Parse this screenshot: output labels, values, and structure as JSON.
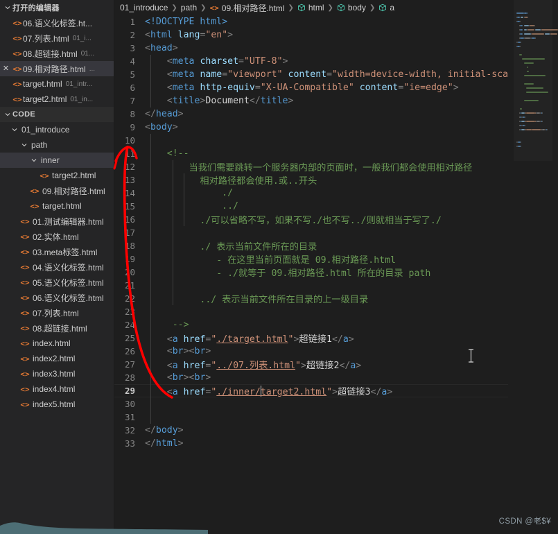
{
  "colors": {
    "editor_bg": "#1e1e1e",
    "sidebar_bg": "#252526",
    "active_row": "#37373d",
    "accent_orange": "#e37933",
    "comment_green": "#6a9955",
    "tag_blue": "#569cd6",
    "attr_lightblue": "#9cdcfe",
    "string_orange": "#ce9178",
    "annotation_red": "#ff0000",
    "teal_band": "#4d6e75"
  },
  "sidebar": {
    "open_editors": {
      "label": "打开的编辑器",
      "chevron": "chevron-down-icon",
      "items": [
        {
          "name": "06.语义化标签.ht...",
          "path": "",
          "icon": "html-file-icon",
          "active": false,
          "close": false
        },
        {
          "name": "07.列表.html",
          "path": "01_i...",
          "icon": "html-file-icon",
          "active": false,
          "close": false
        },
        {
          "name": "08.超链接.html",
          "path": "01...",
          "icon": "html-file-icon",
          "active": false,
          "close": false
        },
        {
          "name": "09.相对路径.html",
          "path": "...",
          "icon": "html-file-icon",
          "active": true,
          "close": true
        },
        {
          "name": "target.html",
          "path": "01_intr...",
          "icon": "html-file-icon",
          "active": false,
          "close": false
        },
        {
          "name": "target2.html",
          "path": "01_in...",
          "icon": "html-file-icon",
          "active": false,
          "close": false
        }
      ],
      "close_glyph": "✕"
    },
    "explorer": {
      "label": "CODE",
      "chevron": "chevron-down-icon",
      "tree": [
        {
          "label": "01_introduce",
          "type": "folder",
          "depth": 1,
          "expanded": true,
          "active": false
        },
        {
          "label": "path",
          "type": "folder",
          "depth": 2,
          "expanded": true,
          "active": false
        },
        {
          "label": "inner",
          "type": "folder",
          "depth": 3,
          "expanded": true,
          "active": true
        },
        {
          "label": "target2.html",
          "type": "file",
          "depth": 4,
          "expanded": false,
          "active": false
        },
        {
          "label": "09.相对路径.html",
          "type": "file",
          "depth": 3,
          "expanded": false,
          "active": false
        },
        {
          "label": "target.html",
          "type": "file",
          "depth": 3,
          "expanded": false,
          "active": false
        },
        {
          "label": "01.测试编辑器.html",
          "type": "file",
          "depth": 2,
          "expanded": false,
          "active": false
        },
        {
          "label": "02.实体.html",
          "type": "file",
          "depth": 2,
          "expanded": false,
          "active": false
        },
        {
          "label": "03.meta标签.html",
          "type": "file",
          "depth": 2,
          "expanded": false,
          "active": false
        },
        {
          "label": "04.语义化标签.html",
          "type": "file",
          "depth": 2,
          "expanded": false,
          "active": false
        },
        {
          "label": "05.语义化标签.html",
          "type": "file",
          "depth": 2,
          "expanded": false,
          "active": false
        },
        {
          "label": "06.语义化标签.html",
          "type": "file",
          "depth": 2,
          "expanded": false,
          "active": false
        },
        {
          "label": "07.列表.html",
          "type": "file",
          "depth": 2,
          "expanded": false,
          "active": false
        },
        {
          "label": "08.超链接.html",
          "type": "file",
          "depth": 2,
          "expanded": false,
          "active": false
        },
        {
          "label": "index.html",
          "type": "file",
          "depth": 2,
          "expanded": false,
          "active": false
        },
        {
          "label": "index2.html",
          "type": "file",
          "depth": 2,
          "expanded": false,
          "active": false
        },
        {
          "label": "index3.html",
          "type": "file",
          "depth": 2,
          "expanded": false,
          "active": false
        },
        {
          "label": "index4.html",
          "type": "file",
          "depth": 2,
          "expanded": false,
          "active": false
        },
        {
          "label": "index5.html",
          "type": "file",
          "depth": 2,
          "expanded": false,
          "active": false
        }
      ]
    }
  },
  "breadcrumb": {
    "separator": "❯",
    "items": [
      {
        "label": "01_introduce",
        "icon": ""
      },
      {
        "label": "path",
        "icon": ""
      },
      {
        "label": "09.相对路径.html",
        "icon": "html-file-icon"
      },
      {
        "label": "html",
        "icon": "symbol-cube-icon"
      },
      {
        "label": "body",
        "icon": "symbol-cube-icon"
      },
      {
        "label": "a",
        "icon": "symbol-cube-icon"
      }
    ]
  },
  "editor": {
    "active_line": 29,
    "total_lines": 33,
    "lines": [
      {
        "n": 1,
        "tokens": [
          {
            "t": "dtd",
            "s": "<!DOCTYPE "
          },
          {
            "t": "name",
            "s": "html"
          },
          {
            "t": "dtd",
            "s": ">"
          }
        ]
      },
      {
        "n": 2,
        "tokens": [
          {
            "t": "pun",
            "s": "<"
          },
          {
            "t": "tag",
            "s": "html"
          },
          {
            "t": "txt",
            "s": " "
          },
          {
            "t": "attr",
            "s": "lang"
          },
          {
            "t": "pun",
            "s": "="
          },
          {
            "t": "str",
            "s": "\"en\""
          },
          {
            "t": "pun",
            "s": ">"
          }
        ]
      },
      {
        "n": 3,
        "tokens": [
          {
            "t": "pun",
            "s": "<"
          },
          {
            "t": "tag",
            "s": "head"
          },
          {
            "t": "pun",
            "s": ">"
          }
        ]
      },
      {
        "n": 4,
        "tokens": [
          {
            "t": "txt",
            "s": "    "
          },
          {
            "t": "pun",
            "s": "<"
          },
          {
            "t": "tag",
            "s": "meta"
          },
          {
            "t": "txt",
            "s": " "
          },
          {
            "t": "attr",
            "s": "charset"
          },
          {
            "t": "pun",
            "s": "="
          },
          {
            "t": "str",
            "s": "\"UTF-8\""
          },
          {
            "t": "pun",
            "s": ">"
          }
        ]
      },
      {
        "n": 5,
        "tokens": [
          {
            "t": "txt",
            "s": "    "
          },
          {
            "t": "pun",
            "s": "<"
          },
          {
            "t": "tag",
            "s": "meta"
          },
          {
            "t": "txt",
            "s": " "
          },
          {
            "t": "attr",
            "s": "name"
          },
          {
            "t": "pun",
            "s": "="
          },
          {
            "t": "str",
            "s": "\"viewport\""
          },
          {
            "t": "txt",
            "s": " "
          },
          {
            "t": "attr",
            "s": "content"
          },
          {
            "t": "pun",
            "s": "="
          },
          {
            "t": "str",
            "s": "\"width=device-width, initial-scal"
          }
        ]
      },
      {
        "n": 6,
        "tokens": [
          {
            "t": "txt",
            "s": "    "
          },
          {
            "t": "pun",
            "s": "<"
          },
          {
            "t": "tag",
            "s": "meta"
          },
          {
            "t": "txt",
            "s": " "
          },
          {
            "t": "attr",
            "s": "http-equiv"
          },
          {
            "t": "pun",
            "s": "="
          },
          {
            "t": "str",
            "s": "\"X-UA-Compatible\""
          },
          {
            "t": "txt",
            "s": " "
          },
          {
            "t": "attr",
            "s": "content"
          },
          {
            "t": "pun",
            "s": "="
          },
          {
            "t": "str",
            "s": "\"ie=edge\""
          },
          {
            "t": "pun",
            "s": ">"
          }
        ]
      },
      {
        "n": 7,
        "tokens": [
          {
            "t": "txt",
            "s": "    "
          },
          {
            "t": "pun",
            "s": "<"
          },
          {
            "t": "tag",
            "s": "title"
          },
          {
            "t": "pun",
            "s": ">"
          },
          {
            "t": "txt",
            "s": "Document"
          },
          {
            "t": "pun",
            "s": "</"
          },
          {
            "t": "tag",
            "s": "title"
          },
          {
            "t": "pun",
            "s": ">"
          }
        ]
      },
      {
        "n": 8,
        "tokens": [
          {
            "t": "pun",
            "s": "</"
          },
          {
            "t": "tag",
            "s": "head"
          },
          {
            "t": "pun",
            "s": ">"
          }
        ]
      },
      {
        "n": 9,
        "tokens": [
          {
            "t": "pun",
            "s": "<"
          },
          {
            "t": "tag",
            "s": "body"
          },
          {
            "t": "pun",
            "s": ">"
          }
        ]
      },
      {
        "n": 10,
        "tokens": []
      },
      {
        "n": 11,
        "tokens": [
          {
            "t": "txt",
            "s": "    "
          },
          {
            "t": "cmt",
            "s": "<!--"
          }
        ]
      },
      {
        "n": 12,
        "tokens": [
          {
            "t": "txt",
            "s": "        "
          },
          {
            "t": "cmt",
            "s": "当我们需要跳转一个服务器内部的页面时，一般我们都会使用相对路径"
          }
        ]
      },
      {
        "n": 13,
        "tokens": [
          {
            "t": "txt",
            "s": "          "
          },
          {
            "t": "cmt",
            "s": "相对路径都会使用.或..开头"
          }
        ]
      },
      {
        "n": 14,
        "tokens": [
          {
            "t": "txt",
            "s": "              "
          },
          {
            "t": "cmt",
            "s": "./"
          }
        ]
      },
      {
        "n": 15,
        "tokens": [
          {
            "t": "txt",
            "s": "              "
          },
          {
            "t": "cmt",
            "s": "../"
          }
        ]
      },
      {
        "n": 16,
        "tokens": [
          {
            "t": "txt",
            "s": "          "
          },
          {
            "t": "cmt",
            "s": "./可以省略不写，如果不写./也不写../则就相当于写了./"
          }
        ]
      },
      {
        "n": 17,
        "tokens": []
      },
      {
        "n": 18,
        "tokens": [
          {
            "t": "txt",
            "s": "          "
          },
          {
            "t": "cmt",
            "s": "./ 表示当前文件所在的目录"
          }
        ]
      },
      {
        "n": 19,
        "tokens": [
          {
            "t": "txt",
            "s": "             "
          },
          {
            "t": "cmt",
            "s": "- 在这里当前页面就是 09.相对路径.html"
          }
        ]
      },
      {
        "n": 20,
        "tokens": [
          {
            "t": "txt",
            "s": "             "
          },
          {
            "t": "cmt",
            "s": "- ./就等于 09.相对路径.html 所在的目录 path"
          }
        ]
      },
      {
        "n": 21,
        "tokens": []
      },
      {
        "n": 22,
        "tokens": [
          {
            "t": "txt",
            "s": "          "
          },
          {
            "t": "cmt",
            "s": "../ 表示当前文件所在目录的上一级目录"
          }
        ]
      },
      {
        "n": 23,
        "tokens": []
      },
      {
        "n": 24,
        "tokens": [
          {
            "t": "txt",
            "s": "     "
          },
          {
            "t": "cmt",
            "s": "-->"
          }
        ]
      },
      {
        "n": 25,
        "tokens": [
          {
            "t": "txt",
            "s": "    "
          },
          {
            "t": "pun",
            "s": "<"
          },
          {
            "t": "tag",
            "s": "a"
          },
          {
            "t": "txt",
            "s": " "
          },
          {
            "t": "attr",
            "s": "href"
          },
          {
            "t": "pun",
            "s": "="
          },
          {
            "t": "str",
            "s": "\""
          },
          {
            "t": "link",
            "s": "./target.html"
          },
          {
            "t": "str",
            "s": "\""
          },
          {
            "t": "pun",
            "s": ">"
          },
          {
            "t": "txt",
            "s": "超链接1"
          },
          {
            "t": "pun",
            "s": "</"
          },
          {
            "t": "tag",
            "s": "a"
          },
          {
            "t": "pun",
            "s": ">"
          }
        ]
      },
      {
        "n": 26,
        "tokens": [
          {
            "t": "txt",
            "s": "    "
          },
          {
            "t": "pun",
            "s": "<"
          },
          {
            "t": "tag",
            "s": "br"
          },
          {
            "t": "pun",
            "s": "><"
          },
          {
            "t": "tag",
            "s": "br"
          },
          {
            "t": "pun",
            "s": ">"
          }
        ]
      },
      {
        "n": 27,
        "tokens": [
          {
            "t": "txt",
            "s": "    "
          },
          {
            "t": "pun",
            "s": "<"
          },
          {
            "t": "tag",
            "s": "a"
          },
          {
            "t": "txt",
            "s": " "
          },
          {
            "t": "attr",
            "s": "href"
          },
          {
            "t": "pun",
            "s": "="
          },
          {
            "t": "str",
            "s": "\""
          },
          {
            "t": "link",
            "s": "../07.列表.html"
          },
          {
            "t": "str",
            "s": "\""
          },
          {
            "t": "pun",
            "s": ">"
          },
          {
            "t": "txt",
            "s": "超链接2"
          },
          {
            "t": "pun",
            "s": "</"
          },
          {
            "t": "tag",
            "s": "a"
          },
          {
            "t": "pun",
            "s": ">"
          }
        ]
      },
      {
        "n": 28,
        "tokens": [
          {
            "t": "txt",
            "s": "    "
          },
          {
            "t": "pun",
            "s": "<"
          },
          {
            "t": "tag",
            "s": "br"
          },
          {
            "t": "pun",
            "s": "><"
          },
          {
            "t": "tag",
            "s": "br"
          },
          {
            "t": "pun",
            "s": ">"
          }
        ]
      },
      {
        "n": 29,
        "tokens": [
          {
            "t": "txt",
            "s": "    "
          },
          {
            "t": "pun",
            "s": "<"
          },
          {
            "t": "tag",
            "s": "a"
          },
          {
            "t": "txt",
            "s": " "
          },
          {
            "t": "attr",
            "s": "href"
          },
          {
            "t": "pun",
            "s": "="
          },
          {
            "t": "str",
            "s": "\""
          },
          {
            "t": "link",
            "s": "./inner/"
          },
          {
            "t": "caret",
            "s": ""
          },
          {
            "t": "link",
            "s": "target2.html"
          },
          {
            "t": "str",
            "s": "\""
          },
          {
            "t": "pun",
            "s": ">"
          },
          {
            "t": "txt",
            "s": "超链接3"
          },
          {
            "t": "pun",
            "s": "</"
          },
          {
            "t": "tag",
            "s": "a"
          },
          {
            "t": "pun",
            "s": ">"
          }
        ]
      },
      {
        "n": 30,
        "tokens": []
      },
      {
        "n": 31,
        "tokens": []
      },
      {
        "n": 32,
        "tokens": [
          {
            "t": "pun",
            "s": "</"
          },
          {
            "t": "tag",
            "s": "body"
          },
          {
            "t": "pun",
            "s": ">"
          }
        ]
      },
      {
        "n": 33,
        "tokens": [
          {
            "t": "pun",
            "s": "</"
          },
          {
            "t": "tag",
            "s": "html"
          },
          {
            "t": "pun",
            "s": ">"
          }
        ]
      }
    ]
  },
  "annotation": {
    "type": "red-arrow",
    "description": "手绘红色箭头 从第29行 ./inner/ 指向第10-11行",
    "color": "#ff0000"
  },
  "watermark": {
    "text": "CSDN @老$¥"
  }
}
